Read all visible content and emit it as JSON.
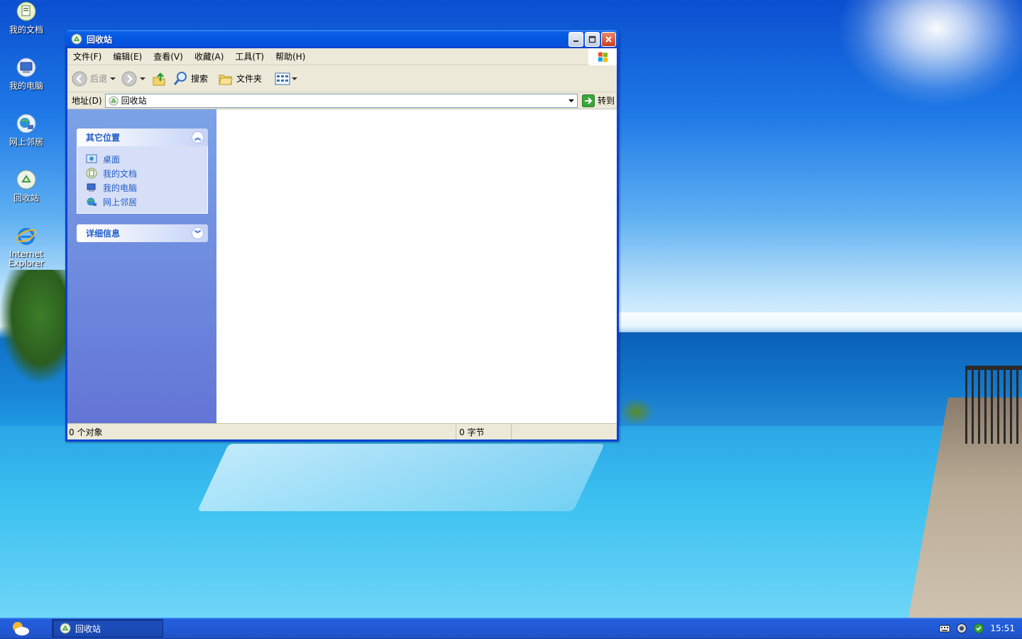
{
  "desktop": {
    "icons": [
      {
        "label": "我的文档"
      },
      {
        "label": "我的电脑"
      },
      {
        "label": "网上邻居"
      },
      {
        "label": "回收站"
      },
      {
        "label": "Internet Explorer"
      }
    ]
  },
  "window": {
    "title": "回收站",
    "menu": [
      "文件(F)",
      "编辑(E)",
      "查看(V)",
      "收藏(A)",
      "工具(T)",
      "帮助(H)"
    ],
    "toolbar": {
      "back": "后退",
      "search": "搜索",
      "folders": "文件夹"
    },
    "address": {
      "label": "地址(D)",
      "value": "回收站",
      "go": "转到"
    },
    "taskpane": {
      "other_places": {
        "title": "其它位置",
        "items": [
          "桌面",
          "我的文档",
          "我的电脑",
          "网上邻居"
        ]
      },
      "details": {
        "title": "详细信息"
      }
    },
    "status": {
      "objects": "0 个对象",
      "size": "0 字节"
    }
  },
  "taskbar": {
    "task": "回收站",
    "clock": "15:51"
  },
  "colors": {
    "title_blue": "#0556e0",
    "taskpane_link": "#215dc6",
    "taskbar_blue": "#225bd8"
  }
}
